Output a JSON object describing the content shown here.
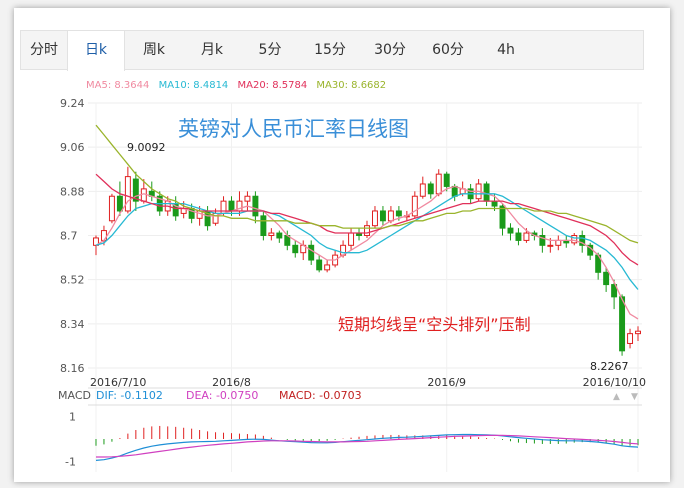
{
  "tabs": [
    {
      "label": "分时",
      "active": false
    },
    {
      "label": "日k",
      "active": true
    },
    {
      "label": "周k",
      "active": false
    },
    {
      "label": "月k",
      "active": false
    },
    {
      "label": "5分",
      "active": false
    },
    {
      "label": "15分",
      "active": false
    },
    {
      "label": "30分",
      "active": false
    },
    {
      "label": "60分",
      "active": false
    },
    {
      "label": "4h",
      "active": false
    }
  ],
  "ma_legend": {
    "ma5": "MA5: 8.3644",
    "ma10": "MA10: 8.4814",
    "ma20": "MA20: 8.5784",
    "ma30": "MA30: 8.6682"
  },
  "colors": {
    "ma5": "#f08aa0",
    "ma10": "#27b9d3",
    "ma20": "#e0305a",
    "ma30": "#9ab42c",
    "up": "#e02020",
    "down": "#1a9a1a",
    "annotation": "#e02020",
    "title": "#3a8fd8",
    "accent": "#1f5fa8"
  },
  "chart_data": {
    "type": "candlestick",
    "title": "英镑对人民币汇率日线图",
    "annotation": "短期均线呈“空头排列”压制",
    "high_label": "9.0092",
    "low_label": "8.2267",
    "y_ticks": [
      "9.24",
      "9.06",
      "8.88",
      "8.7",
      "8.52",
      "8.34",
      "8.16"
    ],
    "ylim": [
      8.16,
      9.24
    ],
    "x_labels": [
      "2016/7/10",
      "2016/8",
      "2016/9",
      "2016/10/10"
    ],
    "candles": [
      [
        8.66,
        8.69,
        8.62,
        8.7
      ],
      [
        8.68,
        8.72,
        8.66,
        8.74
      ],
      [
        8.76,
        8.86,
        8.75,
        8.87
      ],
      [
        8.86,
        8.8,
        8.78,
        8.92
      ],
      [
        8.8,
        8.94,
        8.79,
        8.98
      ],
      [
        8.93,
        8.84,
        8.8,
        8.96
      ],
      [
        8.84,
        8.89,
        8.83,
        8.93
      ],
      [
        8.88,
        8.86,
        8.84,
        8.92
      ],
      [
        8.86,
        8.8,
        8.78,
        8.88
      ],
      [
        8.8,
        8.84,
        8.78,
        8.86
      ],
      [
        8.83,
        8.78,
        8.76,
        8.86
      ],
      [
        8.79,
        8.81,
        8.77,
        8.84
      ],
      [
        8.81,
        8.77,
        8.75,
        8.83
      ],
      [
        8.77,
        8.8,
        8.74,
        8.82
      ],
      [
        8.8,
        8.74,
        8.72,
        8.82
      ],
      [
        8.75,
        8.79,
        8.74,
        8.81
      ],
      [
        8.79,
        8.84,
        8.78,
        8.86
      ],
      [
        8.84,
        8.8,
        8.78,
        8.86
      ],
      [
        8.8,
        8.84,
        8.78,
        8.88
      ],
      [
        8.84,
        8.86,
        8.8,
        8.88
      ],
      [
        8.86,
        8.78,
        8.75,
        8.88
      ],
      [
        8.78,
        8.7,
        8.68,
        8.8
      ],
      [
        8.7,
        8.71,
        8.68,
        8.73
      ],
      [
        8.71,
        8.69,
        8.67,
        8.72
      ],
      [
        8.7,
        8.66,
        8.64,
        8.72
      ],
      [
        8.66,
        8.63,
        8.61,
        8.68
      ],
      [
        8.63,
        8.66,
        8.6,
        8.68
      ],
      [
        8.66,
        8.6,
        8.58,
        8.68
      ],
      [
        8.6,
        8.56,
        8.55,
        8.62
      ],
      [
        8.56,
        8.58,
        8.55,
        8.6
      ],
      [
        8.58,
        8.62,
        8.57,
        8.64
      ],
      [
        8.62,
        8.66,
        8.61,
        8.68
      ],
      [
        8.66,
        8.71,
        8.64,
        8.73
      ],
      [
        8.71,
        8.7,
        8.68,
        8.73
      ],
      [
        8.7,
        8.74,
        8.69,
        8.76
      ],
      [
        8.74,
        8.8,
        8.73,
        8.82
      ],
      [
        8.8,
        8.76,
        8.74,
        8.82
      ],
      [
        8.76,
        8.8,
        8.75,
        8.82
      ],
      [
        8.8,
        8.78,
        8.76,
        8.82
      ],
      [
        8.78,
        8.78,
        8.76,
        8.8
      ],
      [
        8.78,
        8.86,
        8.77,
        8.88
      ],
      [
        8.86,
        8.91,
        8.85,
        8.94
      ],
      [
        8.91,
        8.87,
        8.85,
        8.92
      ],
      [
        8.87,
        8.95,
        8.86,
        8.97
      ],
      [
        8.95,
        8.9,
        8.88,
        8.96
      ],
      [
        8.9,
        8.86,
        8.84,
        8.91
      ],
      [
        8.87,
        8.89,
        8.86,
        8.92
      ],
      [
        8.89,
        8.85,
        8.83,
        8.91
      ],
      [
        8.85,
        8.91,
        8.84,
        8.93
      ],
      [
        8.91,
        8.84,
        8.82,
        8.92
      ],
      [
        8.84,
        8.82,
        8.8,
        8.87
      ],
      [
        8.82,
        8.73,
        8.7,
        8.83
      ],
      [
        8.73,
        8.71,
        8.68,
        8.75
      ],
      [
        8.71,
        8.68,
        8.66,
        8.73
      ],
      [
        8.68,
        8.71,
        8.67,
        8.73
      ],
      [
        8.71,
        8.7,
        8.68,
        8.72
      ],
      [
        8.7,
        8.66,
        8.63,
        8.73
      ],
      [
        8.66,
        8.66,
        8.63,
        8.69
      ],
      [
        8.66,
        8.68,
        8.64,
        8.7
      ],
      [
        8.68,
        8.67,
        8.65,
        8.7
      ],
      [
        8.67,
        8.7,
        8.66,
        8.71
      ],
      [
        8.7,
        8.66,
        8.63,
        8.72
      ],
      [
        8.66,
        8.62,
        8.6,
        8.67
      ],
      [
        8.62,
        8.55,
        8.52,
        8.63
      ],
      [
        8.55,
        8.5,
        8.47,
        8.57
      ],
      [
        8.5,
        8.45,
        8.4,
        8.52
      ],
      [
        8.45,
        8.23,
        8.21,
        8.46
      ],
      [
        8.26,
        8.3,
        8.24,
        8.32
      ],
      [
        8.3,
        8.31,
        8.27,
        8.33
      ]
    ],
    "series": [
      {
        "name": "MA5",
        "values": [
          8.66,
          8.68,
          8.73,
          8.79,
          8.84,
          8.86,
          8.87,
          8.86,
          8.85,
          8.84,
          8.82,
          8.81,
          8.8,
          8.79,
          8.78,
          8.78,
          8.79,
          8.8,
          8.81,
          8.82,
          8.81,
          8.8,
          8.77,
          8.74,
          8.7,
          8.68,
          8.66,
          8.64,
          8.62,
          8.6,
          8.6,
          8.62,
          8.64,
          8.66,
          8.68,
          8.71,
          8.74,
          8.76,
          8.77,
          8.78,
          8.8,
          8.82,
          8.84,
          8.87,
          8.89,
          8.9,
          8.89,
          8.88,
          8.88,
          8.87,
          8.86,
          8.83,
          8.79,
          8.75,
          8.72,
          8.7,
          8.69,
          8.68,
          8.68,
          8.68,
          8.68,
          8.67,
          8.65,
          8.62,
          8.57,
          8.51,
          8.44,
          8.38,
          8.36
        ]
      },
      {
        "name": "MA10",
        "values": [
          8.66,
          8.67,
          8.7,
          8.74,
          8.78,
          8.81,
          8.82,
          8.83,
          8.83,
          8.83,
          8.83,
          8.83,
          8.82,
          8.81,
          8.8,
          8.79,
          8.79,
          8.79,
          8.79,
          8.8,
          8.8,
          8.8,
          8.79,
          8.78,
          8.76,
          8.74,
          8.72,
          8.7,
          8.67,
          8.65,
          8.64,
          8.63,
          8.63,
          8.63,
          8.64,
          8.66,
          8.68,
          8.7,
          8.72,
          8.74,
          8.76,
          8.78,
          8.8,
          8.82,
          8.84,
          8.86,
          8.87,
          8.87,
          8.87,
          8.87,
          8.87,
          8.86,
          8.84,
          8.82,
          8.8,
          8.78,
          8.76,
          8.74,
          8.72,
          8.7,
          8.69,
          8.69,
          8.68,
          8.66,
          8.64,
          8.61,
          8.57,
          8.52,
          8.48
        ]
      },
      {
        "name": "MA20",
        "values": [
          8.95,
          8.92,
          8.89,
          8.87,
          8.86,
          8.85,
          8.84,
          8.83,
          8.82,
          8.82,
          8.81,
          8.81,
          8.81,
          8.8,
          8.8,
          8.8,
          8.8,
          8.8,
          8.8,
          8.8,
          8.8,
          8.8,
          8.79,
          8.79,
          8.78,
          8.77,
          8.76,
          8.75,
          8.74,
          8.72,
          8.71,
          8.71,
          8.71,
          8.71,
          8.71,
          8.72,
          8.73,
          8.74,
          8.75,
          8.76,
          8.77,
          8.78,
          8.79,
          8.8,
          8.81,
          8.82,
          8.83,
          8.83,
          8.84,
          8.84,
          8.84,
          8.84,
          8.83,
          8.83,
          8.82,
          8.81,
          8.8,
          8.79,
          8.78,
          8.77,
          8.76,
          8.75,
          8.74,
          8.72,
          8.7,
          8.67,
          8.63,
          8.6,
          8.58
        ]
      },
      {
        "name": "MA30",
        "values": [
          9.15,
          9.11,
          9.07,
          9.03,
          8.99,
          8.95,
          8.92,
          8.89,
          8.87,
          8.85,
          8.84,
          8.82,
          8.81,
          8.8,
          8.79,
          8.78,
          8.78,
          8.77,
          8.77,
          8.77,
          8.76,
          8.76,
          8.76,
          8.76,
          8.76,
          8.75,
          8.75,
          8.75,
          8.74,
          8.74,
          8.74,
          8.73,
          8.73,
          8.73,
          8.73,
          8.73,
          8.73,
          8.74,
          8.74,
          8.75,
          8.76,
          8.76,
          8.77,
          8.78,
          8.79,
          8.79,
          8.8,
          8.8,
          8.81,
          8.81,
          8.81,
          8.81,
          8.81,
          8.81,
          8.81,
          8.8,
          8.8,
          8.8,
          8.79,
          8.79,
          8.78,
          8.77,
          8.76,
          8.75,
          8.74,
          8.72,
          8.7,
          8.68,
          8.67
        ]
      }
    ],
    "macd": {
      "dif_label": "DIF: -0.1102",
      "dea_label": "DEA: -0.0750",
      "macd_label": "MACD: -0.0703",
      "title": "MACD",
      "y_ticks": [
        "1",
        "-1"
      ],
      "ylim": [
        -1.2,
        1.2
      ],
      "dif": [
        -0.95,
        -0.92,
        -0.85,
        -0.75,
        -0.62,
        -0.5,
        -0.4,
        -0.32,
        -0.26,
        -0.22,
        -0.18,
        -0.15,
        -0.13,
        -0.12,
        -0.11,
        -0.1,
        -0.08,
        -0.06,
        -0.04,
        -0.02,
        -0.01,
        -0.02,
        -0.05,
        -0.08,
        -0.1,
        -0.12,
        -0.14,
        -0.16,
        -0.17,
        -0.17,
        -0.15,
        -0.12,
        -0.09,
        -0.06,
        -0.03,
        0.0,
        0.03,
        0.05,
        0.07,
        0.08,
        0.1,
        0.12,
        0.14,
        0.16,
        0.18,
        0.19,
        0.2,
        0.2,
        0.19,
        0.18,
        0.17,
        0.14,
        0.1,
        0.06,
        0.03,
        0.0,
        -0.03,
        -0.05,
        -0.07,
        -0.08,
        -0.08,
        -0.09,
        -0.11,
        -0.14,
        -0.18,
        -0.23,
        -0.3,
        -0.34,
        -0.36
      ],
      "dea": [
        -0.8,
        -0.8,
        -0.79,
        -0.77,
        -0.74,
        -0.7,
        -0.65,
        -0.6,
        -0.55,
        -0.5,
        -0.45,
        -0.4,
        -0.36,
        -0.32,
        -0.28,
        -0.25,
        -0.22,
        -0.19,
        -0.16,
        -0.13,
        -0.11,
        -0.09,
        -0.08,
        -0.08,
        -0.08,
        -0.09,
        -0.1,
        -0.11,
        -0.12,
        -0.13,
        -0.13,
        -0.13,
        -0.12,
        -0.11,
        -0.1,
        -0.08,
        -0.06,
        -0.04,
        -0.02,
        0.0,
        0.02,
        0.04,
        0.06,
        0.08,
        0.1,
        0.12,
        0.13,
        0.14,
        0.15,
        0.16,
        0.16,
        0.16,
        0.15,
        0.14,
        0.12,
        0.1,
        0.08,
        0.06,
        0.04,
        0.02,
        0.0,
        -0.02,
        -0.04,
        -0.06,
        -0.08,
        -0.11,
        -0.15,
        -0.19,
        -0.22
      ]
    }
  }
}
